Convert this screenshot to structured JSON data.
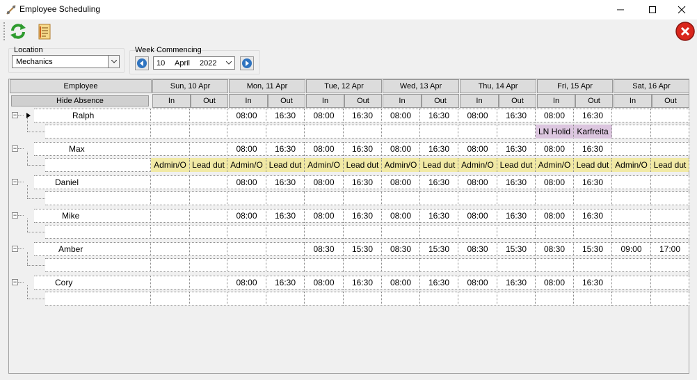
{
  "window": {
    "title": "Employee Scheduling"
  },
  "location": {
    "label": "Location",
    "value": "Mechanics"
  },
  "week": {
    "label": "Week Commencing",
    "day": "10",
    "month": "April",
    "year": "2022"
  },
  "grid": {
    "employee_header": "Employee",
    "hide_absence_label": "Hide Absence",
    "in_label": "In",
    "out_label": "Out",
    "days": [
      "Sun, 10 Apr",
      "Mon, 11 Apr",
      "Tue, 12 Apr",
      "Wed, 13 Apr",
      "Thu, 14 Apr",
      "Fri, 15 Apr",
      "Sat, 16 Apr"
    ]
  },
  "employees": [
    {
      "name": "Ralph",
      "times": [
        "",
        "",
        "08:00",
        "16:30",
        "08:00",
        "16:30",
        "08:00",
        "16:30",
        "08:00",
        "16:30",
        "08:00",
        "16:30",
        "",
        ""
      ],
      "absence": [
        "",
        "",
        "",
        "",
        "",
        "",
        "",
        "",
        "",
        "",
        "LN Holid",
        "Karfreita",
        "",
        ""
      ]
    },
    {
      "name": "Max",
      "times": [
        "",
        "",
        "08:00",
        "16:30",
        "08:00",
        "16:30",
        "08:00",
        "16:30",
        "08:00",
        "16:30",
        "08:00",
        "16:30",
        "",
        ""
      ],
      "absence": [
        "Admin/O",
        "Lead dut",
        "Admin/O",
        "Lead dut",
        "Admin/O",
        "Lead dut",
        "Admin/O",
        "Lead dut",
        "Admin/O",
        "Lead dut",
        "Admin/O",
        "Lead dut",
        "Admin/O",
        "Lead dut"
      ]
    },
    {
      "name": "Daniel",
      "times": [
        "",
        "",
        "08:00",
        "16:30",
        "08:00",
        "16:30",
        "08:00",
        "16:30",
        "08:00",
        "16:30",
        "08:00",
        "16:30",
        "",
        ""
      ],
      "absence": [
        "",
        "",
        "",
        "",
        "",
        "",
        "",
        "",
        "",
        "",
        "",
        "",
        "",
        ""
      ]
    },
    {
      "name": "Mike",
      "times": [
        "",
        "",
        "08:00",
        "16:30",
        "08:00",
        "16:30",
        "08:00",
        "16:30",
        "08:00",
        "16:30",
        "08:00",
        "16:30",
        "",
        ""
      ],
      "absence": [
        "",
        "",
        "",
        "",
        "",
        "",
        "",
        "",
        "",
        "",
        "",
        "",
        "",
        ""
      ]
    },
    {
      "name": "Amber",
      "times": [
        "",
        "",
        "",
        "",
        "08:30",
        "15:30",
        "08:30",
        "15:30",
        "08:30",
        "15:30",
        "08:30",
        "15:30",
        "09:00",
        "17:00"
      ],
      "absence": [
        "",
        "",
        "",
        "",
        "",
        "",
        "",
        "",
        "",
        "",
        "",
        "",
        "",
        ""
      ]
    },
    {
      "name": "Cory",
      "times": [
        "",
        "",
        "08:00",
        "16:30",
        "08:00",
        "16:30",
        "08:00",
        "16:30",
        "08:00",
        "16:30",
        "08:00",
        "16:30",
        "",
        ""
      ],
      "absence": [
        "",
        "",
        "",
        "",
        "",
        "",
        "",
        "",
        "",
        "",
        "",
        "",
        "",
        ""
      ]
    }
  ],
  "colors": {
    "absence": "#f1e9a5",
    "holiday": "#dcc6df"
  }
}
